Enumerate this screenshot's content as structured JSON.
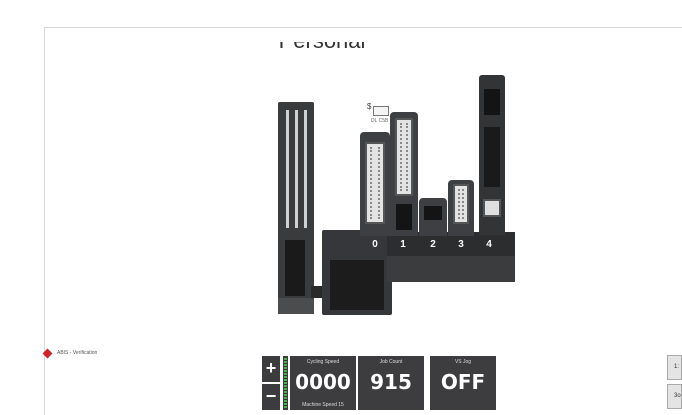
{
  "header": {
    "title": "Personal"
  },
  "machine": {
    "package_icon_label": "DL C5B",
    "package_icon_symbol": "$",
    "feeder_numbers": [
      "0",
      "1",
      "2",
      "3",
      "4"
    ]
  },
  "status": {
    "label": "ABIS - Verification",
    "accent": "#c8262b"
  },
  "controls": {
    "plus_label": "+",
    "minus_label": "−",
    "cycling": {
      "caption": "Cycling Speed",
      "value": "0000",
      "sub": "Machine Speed 15"
    },
    "job": {
      "caption": "Job Count",
      "value": "915"
    },
    "vs_jog": {
      "caption": "VS Jog",
      "value": "OFF"
    },
    "speed_level": 1.0
  },
  "edge_buttons": [
    "1:",
    "3o"
  ]
}
